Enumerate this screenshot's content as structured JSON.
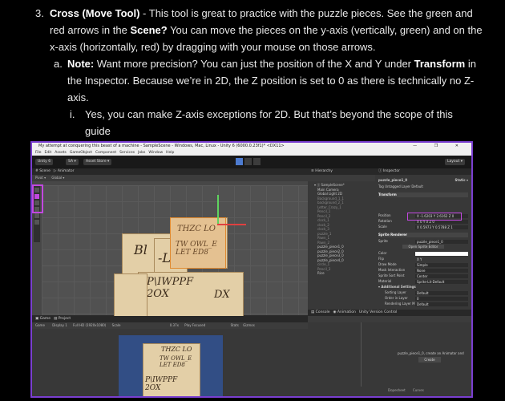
{
  "doc": {
    "item3": {
      "marker": "3.",
      "bold": "Cross (Move Tool)",
      "line1_rest": " - This tool is great to practice with the puzzle pieces. See the green and",
      "line2_pre": "red arrows in the ",
      "line2_bold": "Scene?",
      "line2_rest": " You can move the pieces on the y-axis (vertically, green) and on the",
      "line3": "x-axis (horizontally, red) by dragging with your mouse on those arrows."
    },
    "item_a": {
      "marker": "a.",
      "bold": "Note:",
      "line1_mid": "  Want more precision? You can just the position of the X and Y under ",
      "line1_bold": "Transform",
      "line1_end": " in",
      "line2": "the Inspector. Because we’re in 2D, the Z position is set to 0 as there is technically no Z-",
      "line3": "axis."
    },
    "item_i": {
      "marker": "i.",
      "line1": "Yes, you can make Z-axis exceptions for 2D. But that’s beyond the scope of this",
      "line2": "guide"
    }
  },
  "unity": {
    "window_title": "My attempt at conquering this beast of a machine - SampleScene - Windows, Mac, Linux - Unity 6 (6000.0.23f1)* <DX11>",
    "window_controls": "— ❐ ✕",
    "menu": [
      "File",
      "Edit",
      "Assets",
      "GameObject",
      "Component",
      "Services",
      "Jobs",
      "Window",
      "Help"
    ],
    "toolbar": {
      "account": "Unity 6",
      "sa": "SA ▾",
      "asset_store": "Asset Store ▾",
      "layout": "Layout ▾"
    },
    "scene_tabs": [
      "# Scene",
      "▷ Animator"
    ],
    "scene_mode": [
      "Pivot ▾",
      "Global ▾"
    ],
    "pieces": [
      {
        "text": "THZC LO"
      },
      {
        "text": "TW OWL_E\nLET ED8"
      },
      {
        "text": "Bl"
      },
      {
        "text": "-L"
      },
      {
        "text": "P\\IWPPF\n2OX"
      },
      {
        "text": "DX"
      }
    ],
    "hierarchy": {
      "tab": "≡ Hierarchy",
      "rows": [
        {
          "label": "▾ ⓢ SampleScene*",
          "dim": false
        },
        {
          "label": "Main Camera",
          "dim": false
        },
        {
          "label": "Global Light 2D",
          "dim": false
        },
        {
          "label": "Background_1_1",
          "dim": true
        },
        {
          "label": "background_2_1",
          "dim": true
        },
        {
          "label": "Letter_Crazy_1",
          "dim": true
        },
        {
          "label": "Pencil_1",
          "dim": true
        },
        {
          "label": "Pencil_2",
          "dim": true
        },
        {
          "label": "clock_1",
          "dim": true
        },
        {
          "label": "clock_2",
          "dim": true
        },
        {
          "label": "clock_3",
          "dim": true
        },
        {
          "label": "puzzle_1",
          "dim": true
        },
        {
          "label": "Pawn_1",
          "dim": true
        },
        {
          "label": "Pawn_2",
          "dim": true
        },
        {
          "label": "puzzle_piece1_0",
          "dim": false
        },
        {
          "label": "puzzle_piece2_0",
          "dim": false
        },
        {
          "label": "puzzle_piece3_0",
          "dim": false
        },
        {
          "label": "puzzle_piece4_0",
          "dim": false
        },
        {
          "label": "circle_1",
          "dim": true
        },
        {
          "label": "Pencil_3",
          "dim": true
        },
        {
          "label": "Rice",
          "dim": false
        }
      ]
    },
    "inspector": {
      "tab": "ⓘ Inspector",
      "object": "puzzle_piece1_0",
      "static": "Static ▾",
      "tag": "Untagged",
      "layer": "Default",
      "transform": "Transform",
      "position": "X -1.6203  Y 2.6162  Z 0",
      "rotation": "X 0   Y 0   Z 0",
      "scale": "X 0.5973  Y 0.5788  Z 1",
      "sprite_renderer": "Sprite Renderer",
      "sprite": "puzzle_piece1_0",
      "open_editor": "Open Sprite Editor",
      "color": "",
      "flip": "X   Y",
      "draw_mode": "Simple",
      "mask": "None",
      "sort_point": "Center",
      "material": "Sprite-Lit-Default",
      "additional": "▾ Additional Settings",
      "sorting_layer": "Default",
      "order": "0",
      "rendering_layer": "Default",
      "asset_labels": "Asset Labels",
      "labels": {
        "position": "Position",
        "rotation": "Rotation",
        "scale": "Scale",
        "sprite": "Sprite",
        "color": "Color",
        "flip": "Flip",
        "draw_mode": "Draw Mode",
        "mask": "Mask Interaction",
        "sort_point": "Sprite Sort Point",
        "material": "Material",
        "sorting_layer": "Sorting Layer",
        "order": "Order in Layer",
        "rendering_layer": "Rendering Layer M.",
        "tag": "Tag",
        "layer": "Layer"
      }
    },
    "bottom_left_tabs": [
      "▣ Game",
      "▤ Project"
    ],
    "game_bar": [
      "Game",
      "Display 1",
      "Full HD (1920x1080)",
      "Scale",
      "0.37x",
      "Play Focused",
      "Stats",
      "Gizmos"
    ],
    "console_tabs": [
      "▤ Console",
      "◉ Animation",
      "Unity Version Control"
    ],
    "animation_msg": "puzzle_piece1_0, create an Animator and",
    "create_btn": "Create",
    "footer": [
      "Dopesheet",
      "Curves"
    ]
  }
}
